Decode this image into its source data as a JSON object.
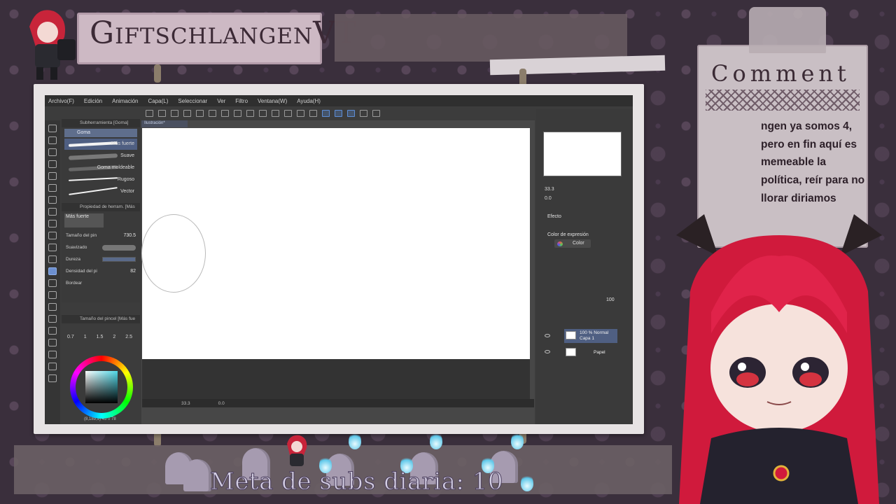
{
  "overlay": {
    "channel_title": "GiftschlangenVT",
    "comment_title": "Comment",
    "comment_text": "ngen ya somos 4, pero en fin aquí es memeable la política, reír para no llorar diriamos",
    "goal_text": "Meta de subs diaria: 10"
  },
  "app": {
    "menu": [
      "Archivo(F)",
      "Edición",
      "Animación",
      "Capa(L)",
      "Seleccionar",
      "Ver",
      "Filtro",
      "Ventana(W)",
      "Ayuda(H)"
    ],
    "canvas_tab": "Ilustración*",
    "subtool_panel": {
      "header": "Subherramienta [Goma]",
      "group": "Goma",
      "brushes": [
        "Más fuerte",
        "Suave",
        "Goma moldeable",
        "Rugoso",
        "Vector"
      ]
    },
    "tool_property": {
      "header": "Propiedad de herram. [Más",
      "preset_name": "Más fuerte",
      "size_label": "Tamaño del pin",
      "size_value": "730.5",
      "smoothing_label": "Suavizado",
      "hardness_label": "Dureza",
      "density_label": "Densidad del pi",
      "density_value": "82",
      "border_label": "Bordear"
    },
    "brush_size_panel": {
      "header": "Tamaño del pincel [Más fue",
      "sizes": [
        "0.7",
        "1",
        "1.5",
        "2",
        "2.5"
      ]
    },
    "color_readout": "(8,189,9)  45  0  78",
    "status": {
      "zoom": "33.3",
      "rotation": "0.0"
    },
    "navigator": {
      "zoom": "33.3",
      "rotation": "0.0"
    },
    "layer_property": {
      "effect_label": "Efecto",
      "expression_label": "Color de expresión",
      "expression_value": "Color"
    },
    "layers": {
      "opacity": "100",
      "layer1_mode": "100 % Normal",
      "layer1_name": "Capa 1",
      "layer2_name": "Papel"
    }
  },
  "colors": {
    "background": "#3a2f3c",
    "card": "#c9bfc4",
    "selection": "#4f5f82",
    "accent_cyan": "#5fc8ea"
  }
}
